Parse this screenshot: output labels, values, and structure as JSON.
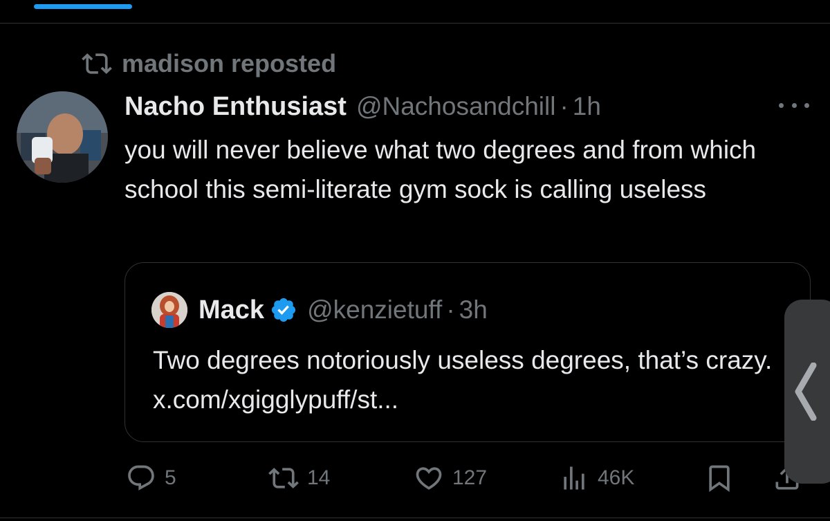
{
  "repost": {
    "label": "madison reposted",
    "icon": "repost-icon"
  },
  "tweet": {
    "display_name": "Nacho Enthusiast",
    "handle": "@Nachosandchill",
    "separator": "·",
    "time": "1h",
    "text": "you will never believe what two degrees and from which school this semi-literate gym sock is calling useless",
    "more_icon": "more-horizontal-icon"
  },
  "quote": {
    "display_name": "Mack",
    "verified_icon": "verified-badge-icon",
    "handle": "@kenzietuff",
    "separator": "·",
    "time": "3h",
    "text": "Two degrees notoriously useless degrees, that’s crazy. x.com/xgigglypuff/st..."
  },
  "actions": {
    "reply_count": "5",
    "repost_count": "14",
    "like_count": "127",
    "views_count": "46K"
  },
  "colors": {
    "background": "#000000",
    "text_primary": "#e7e9ea",
    "text_secondary": "#71767b",
    "accent": "#1d9bf0",
    "border": "#2f3336"
  }
}
